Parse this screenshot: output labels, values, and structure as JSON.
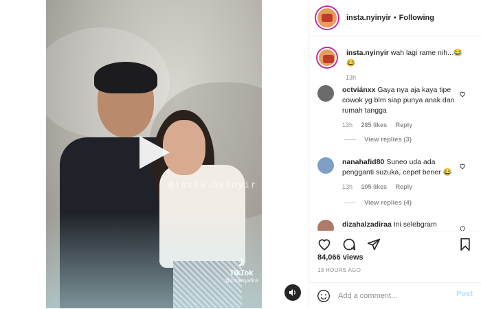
{
  "post": {
    "author": "insta.nyinyir",
    "separator": "•",
    "follow_status": "Following",
    "caption": "wah lagi rame nih...😂😂",
    "caption_time": "13h",
    "views": "84,066 views",
    "time_ago": "13 HOURS AGO"
  },
  "video": {
    "watermark": "@insta.nyinyir",
    "tiktok_name": "TikTok",
    "tiktok_handle": "@instasyafira",
    "tiktok_logo_icon": "tiktok-logo-icon",
    "play_icon": "play-icon",
    "audio_icon": "speaker-icon"
  },
  "comments": [
    {
      "user": "octviánxx",
      "text": "Gaya nya aja kaya tipe cowok yg blm siap punya anak dan rumah tangga",
      "time": "13h",
      "likes": "285 likes",
      "reply": "Reply",
      "view_replies": "View replies (3)",
      "avatar_color": "#6b6b6b"
    },
    {
      "user": "nanahafid80",
      "text": "Suneo uda ada pengganti suzuka, cepet bener 😂",
      "time": "13h",
      "likes": "105 likes",
      "reply": "Reply",
      "view_replies": "View replies (4)",
      "avatar_color": "#7f9fc9"
    },
    {
      "user": "dizahalzadiraa",
      "text": "Ini selebgram",
      "avatar_color": "#b07a6a"
    }
  ],
  "comment_box": {
    "placeholder": "Add a comment...",
    "post_label": "Post"
  },
  "colors": {
    "text": "#262626",
    "muted": "#8e8e8e",
    "post_disabled": "#b2dffc",
    "story_ring": "#c32aa3"
  }
}
